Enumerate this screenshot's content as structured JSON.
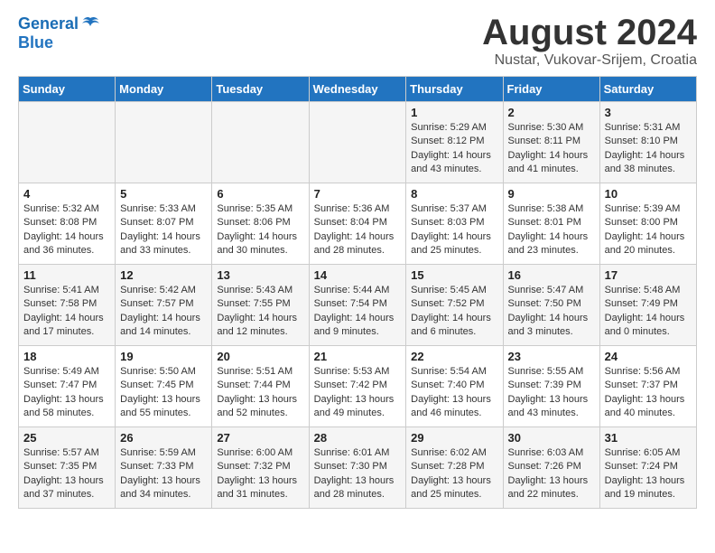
{
  "header": {
    "logo_line1": "General",
    "logo_line2": "Blue",
    "month_title": "August 2024",
    "location": "Nustar, Vukovar-Srijem, Croatia"
  },
  "days_of_week": [
    "Sunday",
    "Monday",
    "Tuesday",
    "Wednesday",
    "Thursday",
    "Friday",
    "Saturday"
  ],
  "weeks": [
    [
      {
        "day": "",
        "info": ""
      },
      {
        "day": "",
        "info": ""
      },
      {
        "day": "",
        "info": ""
      },
      {
        "day": "",
        "info": ""
      },
      {
        "day": "1",
        "info": "Sunrise: 5:29 AM\nSunset: 8:12 PM\nDaylight: 14 hours\nand 43 minutes."
      },
      {
        "day": "2",
        "info": "Sunrise: 5:30 AM\nSunset: 8:11 PM\nDaylight: 14 hours\nand 41 minutes."
      },
      {
        "day": "3",
        "info": "Sunrise: 5:31 AM\nSunset: 8:10 PM\nDaylight: 14 hours\nand 38 minutes."
      }
    ],
    [
      {
        "day": "4",
        "info": "Sunrise: 5:32 AM\nSunset: 8:08 PM\nDaylight: 14 hours\nand 36 minutes."
      },
      {
        "day": "5",
        "info": "Sunrise: 5:33 AM\nSunset: 8:07 PM\nDaylight: 14 hours\nand 33 minutes."
      },
      {
        "day": "6",
        "info": "Sunrise: 5:35 AM\nSunset: 8:06 PM\nDaylight: 14 hours\nand 30 minutes."
      },
      {
        "day": "7",
        "info": "Sunrise: 5:36 AM\nSunset: 8:04 PM\nDaylight: 14 hours\nand 28 minutes."
      },
      {
        "day": "8",
        "info": "Sunrise: 5:37 AM\nSunset: 8:03 PM\nDaylight: 14 hours\nand 25 minutes."
      },
      {
        "day": "9",
        "info": "Sunrise: 5:38 AM\nSunset: 8:01 PM\nDaylight: 14 hours\nand 23 minutes."
      },
      {
        "day": "10",
        "info": "Sunrise: 5:39 AM\nSunset: 8:00 PM\nDaylight: 14 hours\nand 20 minutes."
      }
    ],
    [
      {
        "day": "11",
        "info": "Sunrise: 5:41 AM\nSunset: 7:58 PM\nDaylight: 14 hours\nand 17 minutes."
      },
      {
        "day": "12",
        "info": "Sunrise: 5:42 AM\nSunset: 7:57 PM\nDaylight: 14 hours\nand 14 minutes."
      },
      {
        "day": "13",
        "info": "Sunrise: 5:43 AM\nSunset: 7:55 PM\nDaylight: 14 hours\nand 12 minutes."
      },
      {
        "day": "14",
        "info": "Sunrise: 5:44 AM\nSunset: 7:54 PM\nDaylight: 14 hours\nand 9 minutes."
      },
      {
        "day": "15",
        "info": "Sunrise: 5:45 AM\nSunset: 7:52 PM\nDaylight: 14 hours\nand 6 minutes."
      },
      {
        "day": "16",
        "info": "Sunrise: 5:47 AM\nSunset: 7:50 PM\nDaylight: 14 hours\nand 3 minutes."
      },
      {
        "day": "17",
        "info": "Sunrise: 5:48 AM\nSunset: 7:49 PM\nDaylight: 14 hours\nand 0 minutes."
      }
    ],
    [
      {
        "day": "18",
        "info": "Sunrise: 5:49 AM\nSunset: 7:47 PM\nDaylight: 13 hours\nand 58 minutes."
      },
      {
        "day": "19",
        "info": "Sunrise: 5:50 AM\nSunset: 7:45 PM\nDaylight: 13 hours\nand 55 minutes."
      },
      {
        "day": "20",
        "info": "Sunrise: 5:51 AM\nSunset: 7:44 PM\nDaylight: 13 hours\nand 52 minutes."
      },
      {
        "day": "21",
        "info": "Sunrise: 5:53 AM\nSunset: 7:42 PM\nDaylight: 13 hours\nand 49 minutes."
      },
      {
        "day": "22",
        "info": "Sunrise: 5:54 AM\nSunset: 7:40 PM\nDaylight: 13 hours\nand 46 minutes."
      },
      {
        "day": "23",
        "info": "Sunrise: 5:55 AM\nSunset: 7:39 PM\nDaylight: 13 hours\nand 43 minutes."
      },
      {
        "day": "24",
        "info": "Sunrise: 5:56 AM\nSunset: 7:37 PM\nDaylight: 13 hours\nand 40 minutes."
      }
    ],
    [
      {
        "day": "25",
        "info": "Sunrise: 5:57 AM\nSunset: 7:35 PM\nDaylight: 13 hours\nand 37 minutes."
      },
      {
        "day": "26",
        "info": "Sunrise: 5:59 AM\nSunset: 7:33 PM\nDaylight: 13 hours\nand 34 minutes."
      },
      {
        "day": "27",
        "info": "Sunrise: 6:00 AM\nSunset: 7:32 PM\nDaylight: 13 hours\nand 31 minutes."
      },
      {
        "day": "28",
        "info": "Sunrise: 6:01 AM\nSunset: 7:30 PM\nDaylight: 13 hours\nand 28 minutes."
      },
      {
        "day": "29",
        "info": "Sunrise: 6:02 AM\nSunset: 7:28 PM\nDaylight: 13 hours\nand 25 minutes."
      },
      {
        "day": "30",
        "info": "Sunrise: 6:03 AM\nSunset: 7:26 PM\nDaylight: 13 hours\nand 22 minutes."
      },
      {
        "day": "31",
        "info": "Sunrise: 6:05 AM\nSunset: 7:24 PM\nDaylight: 13 hours\nand 19 minutes."
      }
    ]
  ]
}
